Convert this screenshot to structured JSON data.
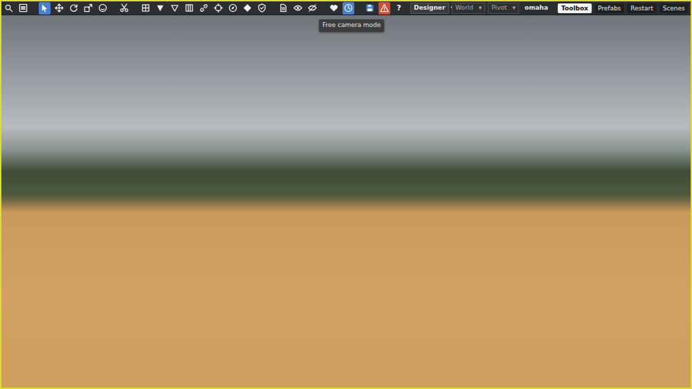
{
  "toolbar": {
    "groups": [
      [
        {
          "kind": "search",
          "selected": false
        },
        {
          "kind": "menu",
          "selected": false
        }
      ],
      [
        {
          "kind": "select",
          "selected": true
        },
        {
          "kind": "move",
          "selected": false
        },
        {
          "kind": "rotate",
          "selected": false
        },
        {
          "kind": "scale",
          "selected": false
        },
        {
          "kind": "smile",
          "selected": false
        }
      ],
      [
        {
          "kind": "cut",
          "selected": false
        }
      ],
      [
        {
          "kind": "snap",
          "selected": false
        },
        {
          "kind": "drop",
          "selected": false
        },
        {
          "kind": "dropoutline",
          "selected": false
        },
        {
          "kind": "columns",
          "selected": false
        },
        {
          "kind": "link",
          "selected": false
        },
        {
          "kind": "target",
          "selected": false
        },
        {
          "kind": "compass",
          "selected": false
        },
        {
          "kind": "diamond",
          "selected": false
        },
        {
          "kind": "shield",
          "selected": false
        }
      ],
      [
        {
          "kind": "page",
          "selected": false
        },
        {
          "kind": "eye",
          "selected": false
        },
        {
          "kind": "eyeoff",
          "selected": false
        }
      ],
      [
        {
          "kind": "heart",
          "selected": false
        },
        {
          "kind": "clock",
          "selected": true
        }
      ],
      [
        {
          "kind": "save",
          "selected": false
        },
        {
          "kind": "warning",
          "selected": false
        },
        {
          "kind": "help",
          "selected": false,
          "label": "?"
        }
      ]
    ],
    "mode": {
      "label": "Designer",
      "arrow": "▾"
    },
    "space": {
      "label": "World",
      "arrow": "▾"
    },
    "pivot": {
      "label": "Pivot",
      "arrow": "▾"
    },
    "scene_name": "omaha",
    "buttons": [
      {
        "label": "Toolbox",
        "selected": true
      },
      {
        "label": "Prefabs",
        "selected": false
      },
      {
        "label": "Restart",
        "selected": false
      },
      {
        "label": "Scenes",
        "selected": false
      }
    ],
    "close": "✖"
  },
  "tooltip": "Free camera mode"
}
